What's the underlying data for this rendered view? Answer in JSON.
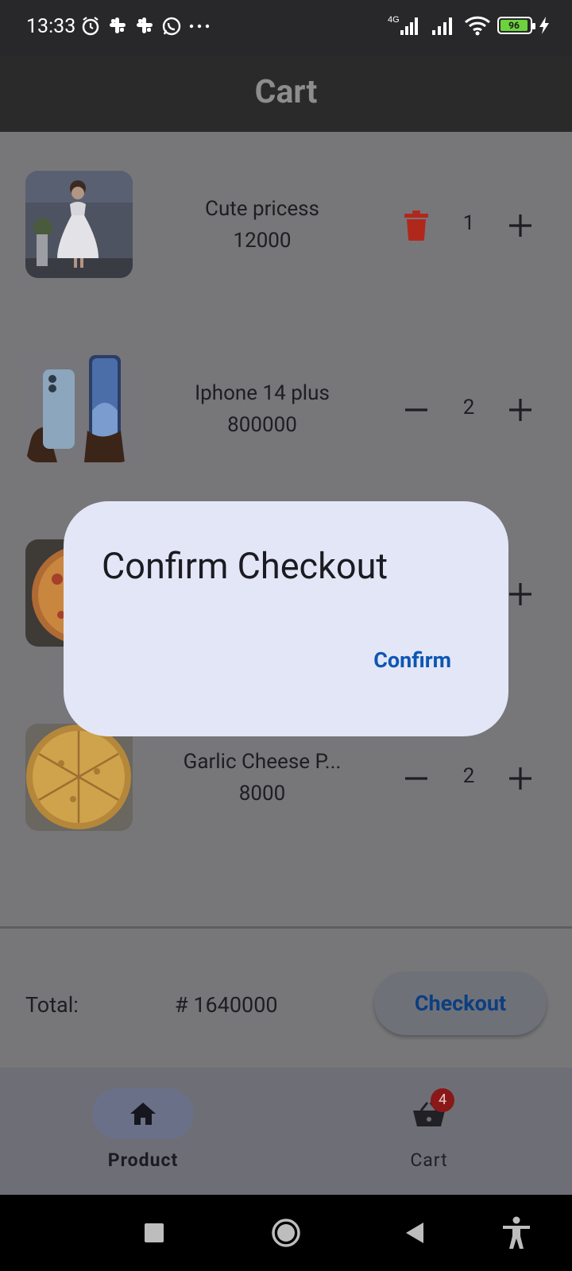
{
  "status_bar": {
    "time": "13:33",
    "network": "4G",
    "battery": "96"
  },
  "app_bar": {
    "title": "Cart"
  },
  "items": [
    {
      "name": "Cute pricess",
      "price": "12000",
      "qty": "1",
      "left_action": "delete"
    },
    {
      "name": "Iphone 14 plus",
      "price": "800000",
      "qty": "2",
      "left_action": "minus"
    },
    {
      "name": "",
      "price": "",
      "qty": "",
      "left_action": "hidden"
    },
    {
      "name": "Garlic Cheese P...",
      "price": "8000",
      "qty": "2",
      "left_action": "minus"
    }
  ],
  "total": {
    "label": "Total:",
    "value": "# 1640000"
  },
  "checkout_label": "Checkout",
  "bottom_nav": {
    "product_label": "Product",
    "cart_label": "Cart",
    "cart_badge": "4"
  },
  "dialog": {
    "title": "Confirm Checkout",
    "confirm_label": "Confirm"
  },
  "colors": {
    "scrim": "#777679",
    "dialog_bg": "#e3e6f6",
    "accent": "#0d56b4",
    "delete": "#b0281c",
    "badge": "#8a1818"
  }
}
